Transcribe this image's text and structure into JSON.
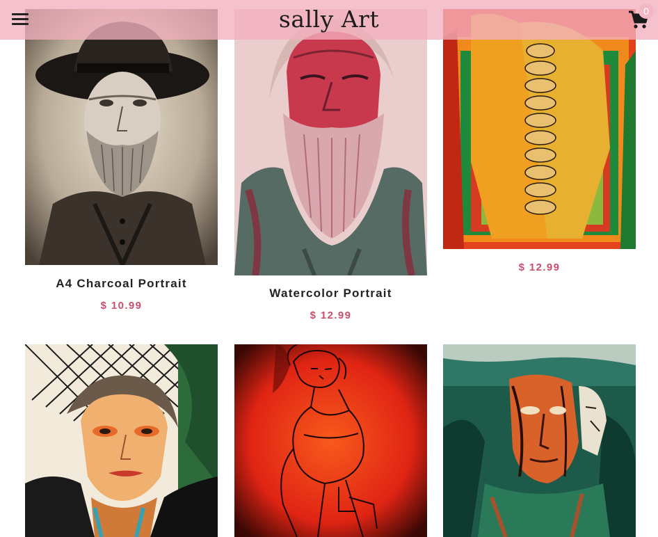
{
  "header": {
    "site_title": "sally Art",
    "menu_icon": "hamburger-menu-icon",
    "cart_icon": "shopping-cart-icon",
    "cart_count": "0",
    "bar_color": "#f2b0be"
  },
  "products": [
    {
      "title": "A4 Charcoal Portrait",
      "price": "$ 10.99",
      "image": "charcoal portrait of bearded man in hat"
    },
    {
      "title": "Watercolor Portrait",
      "price": "$ 12.99",
      "image": "watercolor portrait of old man with long white beard"
    },
    {
      "title": "",
      "price": "$ 12.99",
      "image": "abstract figure with stacked faces in orange, green and red"
    },
    {
      "title": "",
      "price": "",
      "image": "portrait of woman with orange face and dark net background"
    },
    {
      "title": "",
      "price": "",
      "image": "ink sketch of seated woman on red background"
    },
    {
      "title": "",
      "price": "",
      "image": "abstract double face in orange and teal"
    }
  ],
  "colors": {
    "price": "#c94f6d",
    "title": "#222222"
  }
}
